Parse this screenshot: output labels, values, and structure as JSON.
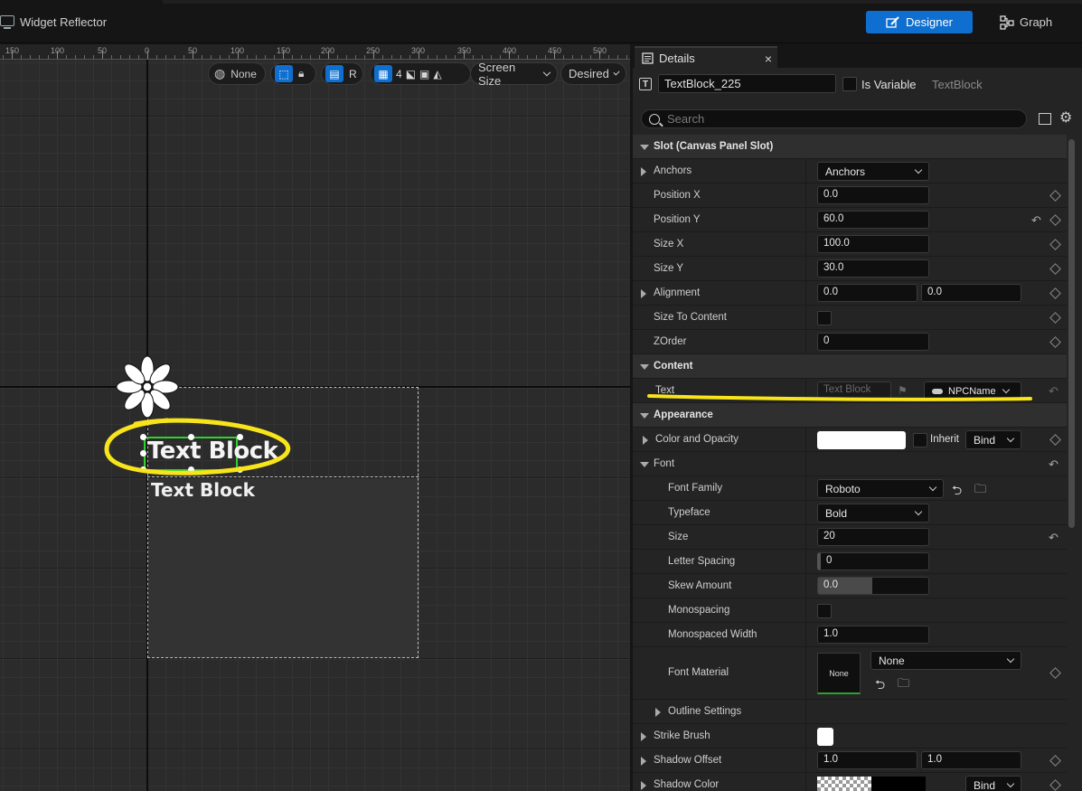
{
  "topbar": {
    "title": "Widget Reflector",
    "designer_label": "Designer",
    "graph_label": "Graph",
    "accent": "#0f6fd0"
  },
  "ruler": {
    "labels": [
      "150",
      "100",
      "50",
      "0",
      "50",
      "100",
      "150",
      "200",
      "250",
      "300",
      "350",
      "400",
      "450",
      "500"
    ]
  },
  "viewport_toolbar": {
    "localization": "None",
    "four_label": "4",
    "r_label": "R",
    "screen_size": "Screen Size",
    "desired": "Desired"
  },
  "canvas": {
    "selected_text": "Text Block",
    "second_text": "Text Block",
    "annotation_color": "#f7e41a",
    "selection_color": "#2ed12e"
  },
  "details": {
    "tab_label": "Details",
    "close_glyph": "×",
    "widget_name": "TextBlock_225",
    "is_variable_label": "Is Variable",
    "widget_type": "TextBlock",
    "search_placeholder": "Search",
    "sections": {
      "slot": "Slot (Canvas Panel Slot)",
      "content": "Content",
      "appearance": "Appearance"
    },
    "props": {
      "anchors_label": "Anchors",
      "anchors_value": "Anchors",
      "position_x_label": "Position X",
      "position_x": "0.0",
      "position_y_label": "Position Y",
      "position_y": "60.0",
      "size_x_label": "Size X",
      "size_x": "100.0",
      "size_y_label": "Size Y",
      "size_y": "30.0",
      "alignment_label": "Alignment",
      "alignment_x": "0.0",
      "alignment_y": "0.0",
      "size_to_content_label": "Size To Content",
      "zorder_label": "ZOrder",
      "zorder": "0",
      "text_label": "Text",
      "text_placeholder": "Text Block",
      "text_binding": "NPCName",
      "color_opacity_label": "Color and Opacity",
      "inherit_label": "Inherit",
      "bind_label": "Bind",
      "font_label": "Font",
      "font_family_label": "Font Family",
      "font_family": "Roboto",
      "typeface_label": "Typeface",
      "typeface": "Bold",
      "size_label": "Size",
      "size": "20",
      "letter_spacing_label": "Letter Spacing",
      "letter_spacing": "0",
      "skew_label": "Skew Amount",
      "skew": "0.0",
      "monospacing_label": "Monospacing",
      "mono_width_label": "Monospaced Width",
      "mono_width": "1.0",
      "font_material_label": "Font Material",
      "font_material_thumb": "None",
      "font_material": "None",
      "outline_label": "Outline Settings",
      "strike_label": "Strike Brush",
      "shadow_offset_label": "Shadow Offset",
      "shadow_offset_x": "1.0",
      "shadow_offset_y": "1.0",
      "shadow_color_label": "Shadow Color",
      "shadow_bind_label": "Bind"
    }
  }
}
